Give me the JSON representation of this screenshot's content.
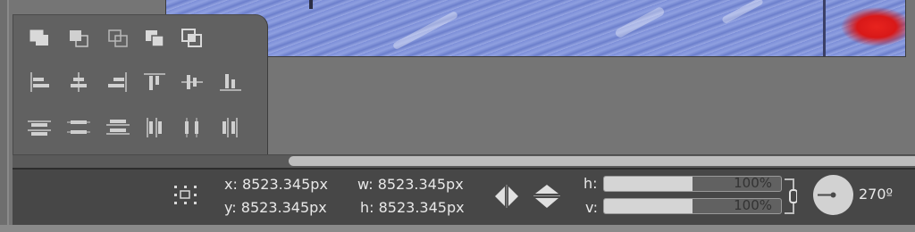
{
  "status": {
    "x_label": "x: 8523.345px",
    "y_label": "y: 8523.345px",
    "w_label": "w: 8523.345px",
    "h_label": "h: 8523.345px",
    "scale_h_label": "h:",
    "scale_v_label": "v:",
    "scale_h_value": "100%",
    "scale_v_value": "100%",
    "scale_h_fill_percent": 50,
    "scale_v_fill_percent": 50,
    "rotation": "270º"
  },
  "palette": {
    "rows": [
      [
        "bring-to-front-icon",
        "bring-forward-icon",
        "intersect-icon",
        "send-backward-icon",
        "send-to-back-icon"
      ],
      [
        "align-left-icon",
        "align-center-horizontal-icon",
        "align-right-icon",
        "align-top-icon",
        "align-center-vertical-icon",
        "align-bottom-icon"
      ],
      [
        "distribute-top-icon",
        "distribute-center-vertical-icon",
        "distribute-bottom-icon",
        "distribute-left-icon",
        "distribute-center-horizontal-icon",
        "distribute-right-icon"
      ]
    ]
  },
  "colors": {
    "background": "#757575",
    "palette": "#616161",
    "statusbar": "#474747",
    "text": "#e8e8e8",
    "accent_red": "#e8231e",
    "canvas_blue": "#7f8fd6"
  }
}
